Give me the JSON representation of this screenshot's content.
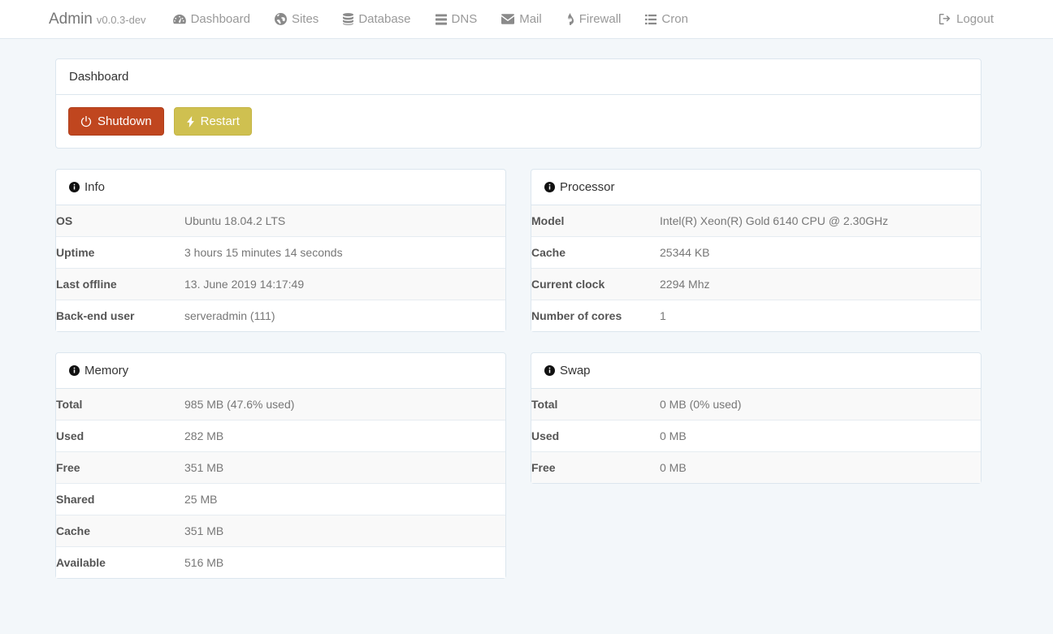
{
  "navbar": {
    "brand": {
      "name": "Admin",
      "version": "v0.0.3-dev"
    },
    "items": [
      {
        "label": "Dashboard",
        "icon": "tachometer-icon",
        "name": "nav-dashboard"
      },
      {
        "label": "Sites",
        "icon": "globe-icon",
        "name": "nav-sites"
      },
      {
        "label": "Database",
        "icon": "database-icon",
        "name": "nav-database"
      },
      {
        "label": "DNS",
        "icon": "server-icon",
        "name": "nav-dns"
      },
      {
        "label": "Mail",
        "icon": "envelope-icon",
        "name": "nav-mail"
      },
      {
        "label": "Firewall",
        "icon": "fire-icon",
        "name": "nav-firewall"
      },
      {
        "label": "Cron",
        "icon": "list-icon",
        "name": "nav-cron"
      }
    ],
    "logout": {
      "label": "Logout",
      "icon": "sign-out-icon"
    }
  },
  "dashboard_panel": {
    "title": "Dashboard",
    "buttons": {
      "shutdown": {
        "label": "Shutdown",
        "icon": "power-off-icon",
        "color": "#c0461f"
      },
      "restart": {
        "label": "Restart",
        "icon": "bolt-icon",
        "color": "#cfc050"
      }
    }
  },
  "panels": {
    "info": {
      "title": "Info",
      "icon": "info-circle-icon",
      "rows": [
        {
          "key": "OS",
          "value": "Ubuntu 18.04.2 LTS"
        },
        {
          "key": "Uptime",
          "value": "3 hours 15 minutes 14 seconds"
        },
        {
          "key": "Last offline",
          "value": "13. June 2019 14:17:49"
        },
        {
          "key": "Back-end user",
          "value": "serveradmin (111)"
        }
      ]
    },
    "processor": {
      "title": "Processor",
      "icon": "info-circle-icon",
      "rows": [
        {
          "key": "Model",
          "value": "Intel(R) Xeon(R) Gold 6140 CPU @ 2.30GHz"
        },
        {
          "key": "Cache",
          "value": "25344 KB"
        },
        {
          "key": "Current clock",
          "value": "2294 Mhz"
        },
        {
          "key": "Number of cores",
          "value": "1"
        }
      ]
    },
    "memory": {
      "title": "Memory",
      "icon": "info-circle-icon",
      "rows": [
        {
          "key": "Total",
          "value": "985 MB (47.6% used)"
        },
        {
          "key": "Used",
          "value": "282 MB"
        },
        {
          "key": "Free",
          "value": "351 MB"
        },
        {
          "key": "Shared",
          "value": "25 MB"
        },
        {
          "key": "Cache",
          "value": "351 MB"
        },
        {
          "key": "Available",
          "value": "516 MB"
        }
      ]
    },
    "swap": {
      "title": "Swap",
      "icon": "info-circle-icon",
      "rows": [
        {
          "key": "Total",
          "value": "0 MB (0% used)"
        },
        {
          "key": "Used",
          "value": "0 MB"
        },
        {
          "key": "Free",
          "value": "0 MB"
        }
      ]
    }
  },
  "colors": {
    "page_background": "#f3f7fa",
    "panel_border": "#dce6ee",
    "nav_text": "#999999",
    "stripe": "#f9f9f9"
  }
}
